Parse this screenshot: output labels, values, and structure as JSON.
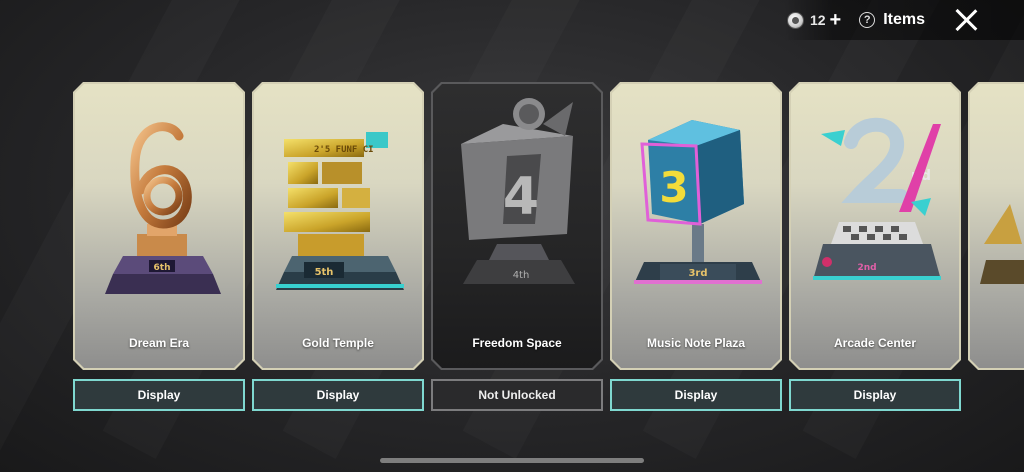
{
  "header": {
    "currency_amount": "12",
    "items_label": "Items"
  },
  "cards": [
    {
      "name": "Dream Era",
      "button": "Display",
      "rank_label": "6th",
      "rank_number": "6",
      "locked": false
    },
    {
      "name": "Gold Temple",
      "button": "Display",
      "rank_label": "5th",
      "rank_number": "5",
      "locked": false
    },
    {
      "name": "Freedom Space",
      "button": "Not Unlocked",
      "rank_label": "4th",
      "rank_number": "4",
      "locked": true
    },
    {
      "name": "Music Note Plaza",
      "button": "Display",
      "rank_label": "3rd",
      "rank_number": "3",
      "locked": false
    },
    {
      "name": "Arcade Center",
      "button": "Display",
      "rank_label": "2nd",
      "rank_number": "2",
      "locked": false
    }
  ],
  "colors": {
    "display_border": "#7fd8d0",
    "card_frame": "#d4d0b5",
    "locked_frame": "#5a5a5c"
  }
}
